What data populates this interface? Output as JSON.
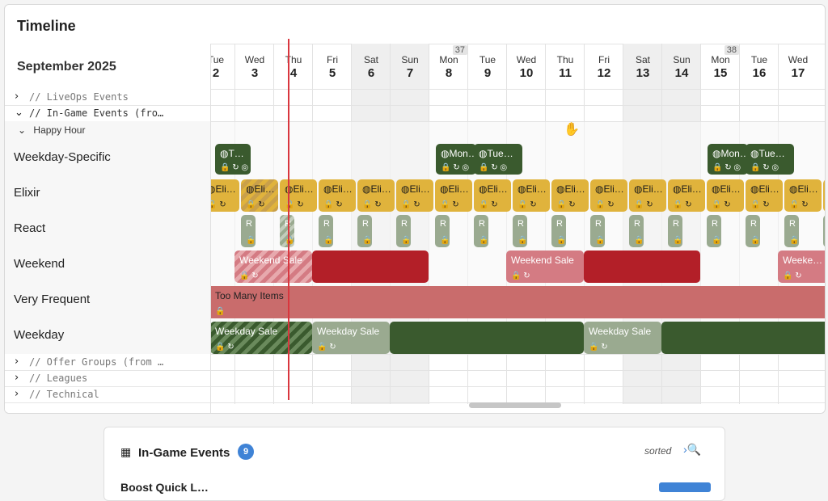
{
  "panel": {
    "title": "Timeline",
    "month": "September 2025"
  },
  "sidebar": {
    "liveops": "// LiveOps Events",
    "ingame": "// In-Game Events (fro…",
    "happy_hour": "Happy Hour",
    "rows": [
      "Weekday-Specific",
      "Elixir",
      "React",
      "Weekend",
      "Very Frequent",
      "Weekday"
    ],
    "offer_groups": "// Offer Groups (from …",
    "leagues": "// Leagues",
    "technical": "// Technical"
  },
  "days": [
    {
      "name": "Tue",
      "num": "2",
      "weekend": false,
      "week": ""
    },
    {
      "name": "Wed",
      "num": "3",
      "weekend": false,
      "week": ""
    },
    {
      "name": "Thu",
      "num": "4",
      "weekend": false,
      "week": ""
    },
    {
      "name": "Fri",
      "num": "5",
      "weekend": false,
      "week": ""
    },
    {
      "name": "Sat",
      "num": "6",
      "weekend": true,
      "week": ""
    },
    {
      "name": "Sun",
      "num": "7",
      "weekend": true,
      "week": ""
    },
    {
      "name": "Mon",
      "num": "8",
      "weekend": false,
      "week": "37"
    },
    {
      "name": "Tue",
      "num": "9",
      "weekend": false,
      "week": ""
    },
    {
      "name": "Wed",
      "num": "10",
      "weekend": false,
      "week": ""
    },
    {
      "name": "Thu",
      "num": "11",
      "weekend": false,
      "week": ""
    },
    {
      "name": "Fri",
      "num": "12",
      "weekend": false,
      "week": ""
    },
    {
      "name": "Sat",
      "num": "13",
      "weekend": true,
      "week": ""
    },
    {
      "name": "Sun",
      "num": "14",
      "weekend": true,
      "week": ""
    },
    {
      "name": "Mon",
      "num": "15",
      "weekend": false,
      "week": "38"
    },
    {
      "name": "Tue",
      "num": "16",
      "weekend": false,
      "week": ""
    },
    {
      "name": "Wed",
      "num": "17",
      "weekend": false,
      "week": ""
    }
  ],
  "events": {
    "weekday_specific": [
      "◍T…",
      "◍Mon…",
      "◍Tue…",
      "◍Mon…",
      "◍Tue…"
    ],
    "elixir_label": "◍Eli…",
    "react_label": "R",
    "weekend_sale": "Weekend Sale",
    "weekend_sale_short": "Weeke…",
    "too_many": "Too Many Items",
    "weekday_sale": "Weekday Sale"
  },
  "icons": {
    "lock_repeat_target": "🔒 ↻ ◎",
    "lock_repeat": "🔒 ↻",
    "lock": "🔒"
  },
  "card": {
    "title": "In-Game Events",
    "count": "9",
    "sorted": "sorted",
    "action": "›🔍",
    "row": "Boost Quick L…"
  },
  "colors": {
    "accent": "#3f83d6",
    "now_line": "#d9363e"
  }
}
